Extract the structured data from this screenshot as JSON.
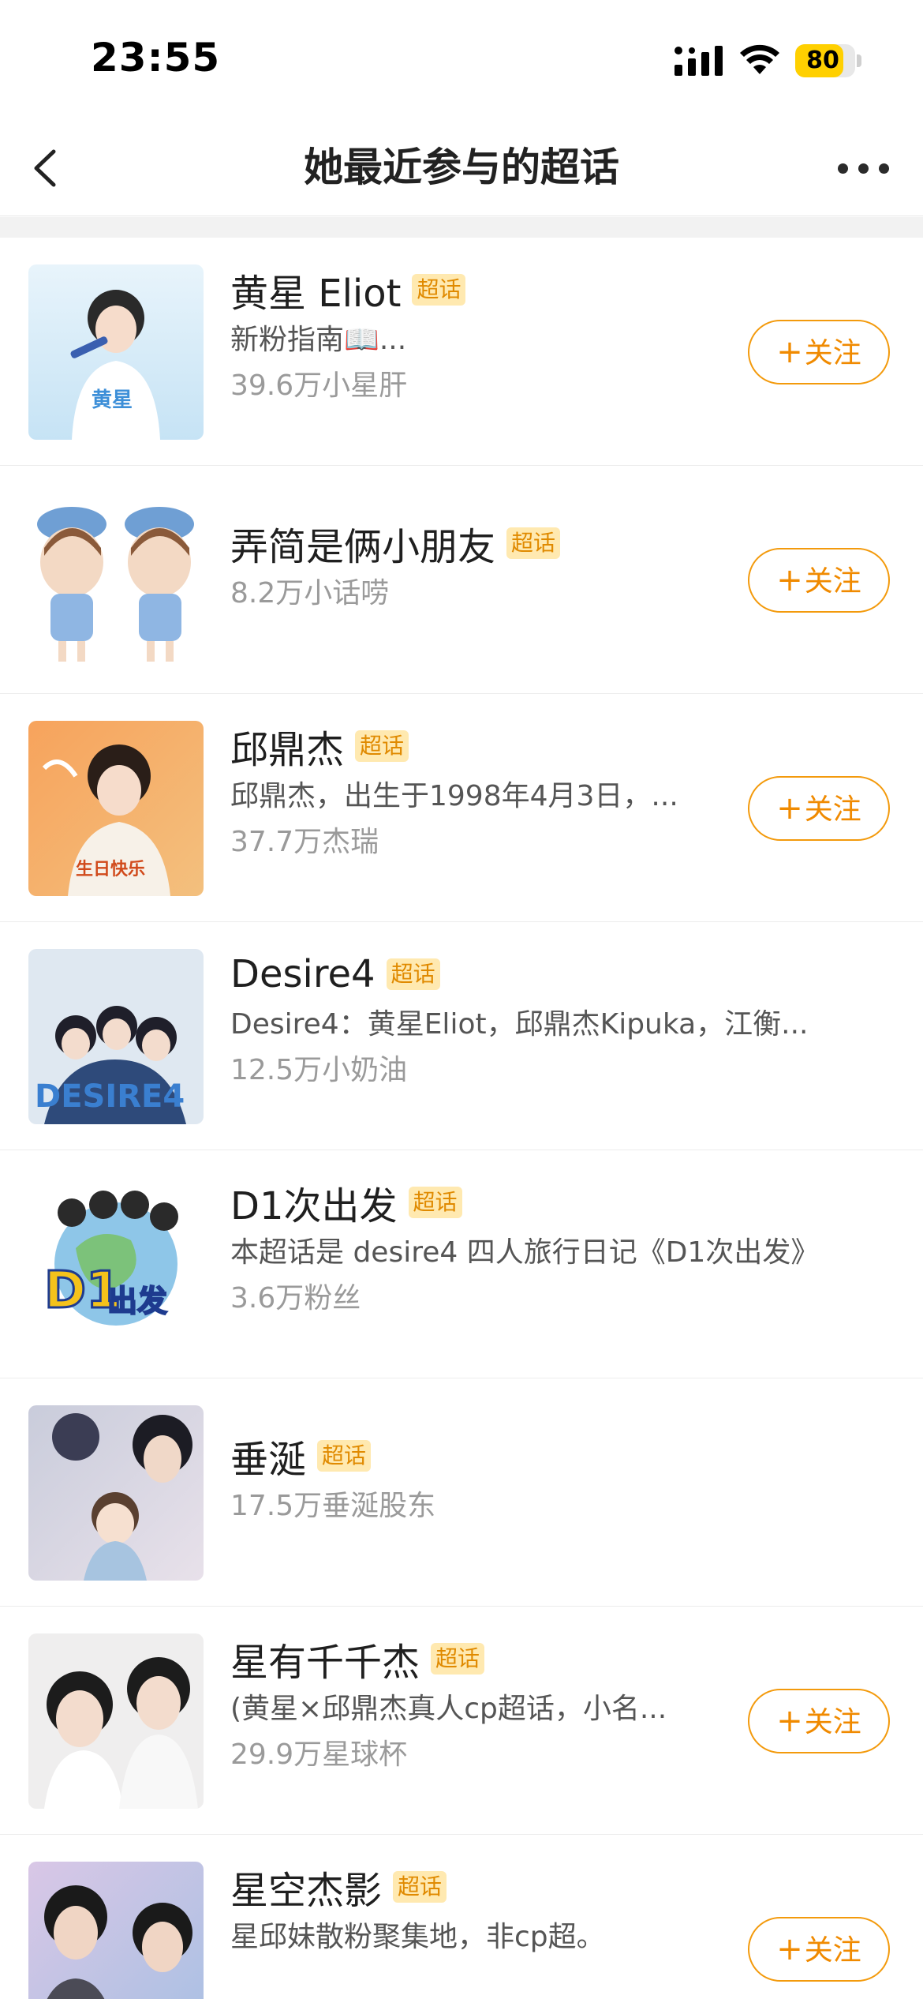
{
  "status_bar": {
    "time": "23:55",
    "battery": "80",
    "battery_fraction": 0.8
  },
  "nav": {
    "title": "她最近参与的超话",
    "back_icon": "chevron-left-icon",
    "more_icon": "more-dots-icon"
  },
  "colors": {
    "accent": "#f08a00",
    "tag_bg": "#ffe9b0",
    "tag_text": "#e08a00"
  },
  "topics": [
    {
      "name": "黄星 Eliot",
      "tag": "超话",
      "desc": "新粉指南📖...",
      "fans": "39.6万小星肝",
      "follow": "关注"
    },
    {
      "name": "弄简是俩小朋友",
      "tag": "超话",
      "desc": "",
      "fans": "8.2万小话唠",
      "follow": "关注"
    },
    {
      "name": "邱鼎杰",
      "tag": "超话",
      "desc": "邱鼎杰，出生于1998年4月3日，...",
      "fans": "37.7万杰瑞",
      "follow": "关注"
    },
    {
      "name": "Desire4",
      "tag": "超话",
      "desc": "Desire4：黄星Eliot，邱鼎杰Kipuka，江衡...",
      "fans": "12.5万小奶油",
      "follow": ""
    },
    {
      "name": "D1次出发",
      "tag": "超话",
      "desc": "本超话是 desire4 四人旅行日记《D1次出发》",
      "fans": "3.6万粉丝",
      "follow": ""
    },
    {
      "name": "垂涎",
      "tag": "超话",
      "desc": "",
      "fans": "17.5万垂涎股东",
      "follow": ""
    },
    {
      "name": "星有千千杰",
      "tag": "超话",
      "desc": "(黄星×邱鼎杰真人cp超话，小名...",
      "fans": "29.9万星球杯",
      "follow": "关注"
    },
    {
      "name": "星空杰影",
      "tag": "超话",
      "desc": "星邱妹散粉聚集地，非cp超。",
      "fans": "",
      "follow": "关注"
    }
  ]
}
